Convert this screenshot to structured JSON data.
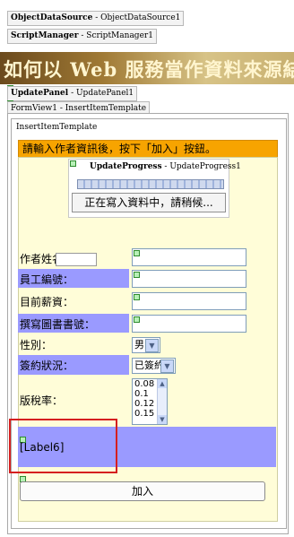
{
  "controls": {
    "objectdatasource": {
      "type": "ObjectDataSource",
      "id": "ObjectDataSource1"
    },
    "scriptmanager": {
      "type": "ScriptManager",
      "id": "ScriptManager1"
    },
    "updatepanel": {
      "type": "UpdatePanel",
      "id": "UpdatePanel1"
    },
    "formview": {
      "text": "FormView1 - InsertItemTemplate"
    },
    "template_title": "InsertItemTemplate",
    "updateprogress": {
      "type": "UpdateProgress",
      "id": "UpdateProgress1"
    }
  },
  "banner": {
    "text": "如何以 Web 服務當作資料來源結合 F"
  },
  "notice": "請輸入作者資訊後，按下「加入」按鈕。",
  "progress": {
    "message": "正在寫入資料中，請稍候..."
  },
  "form": {
    "rows": [
      {
        "label": "作者姓名："
      },
      {
        "label": "員工編號："
      },
      {
        "label": "目前薪資："
      },
      {
        "label": "撰寫圖書書號："
      },
      {
        "label": "性別：",
        "value": "男"
      },
      {
        "label": "簽約狀況：",
        "value": "已簽約"
      },
      {
        "label": "版稅率：",
        "options": [
          "0.08",
          "0.1",
          "0.12",
          "0.15"
        ]
      }
    ],
    "label6": "[Label6]",
    "add_button": "加入"
  }
}
